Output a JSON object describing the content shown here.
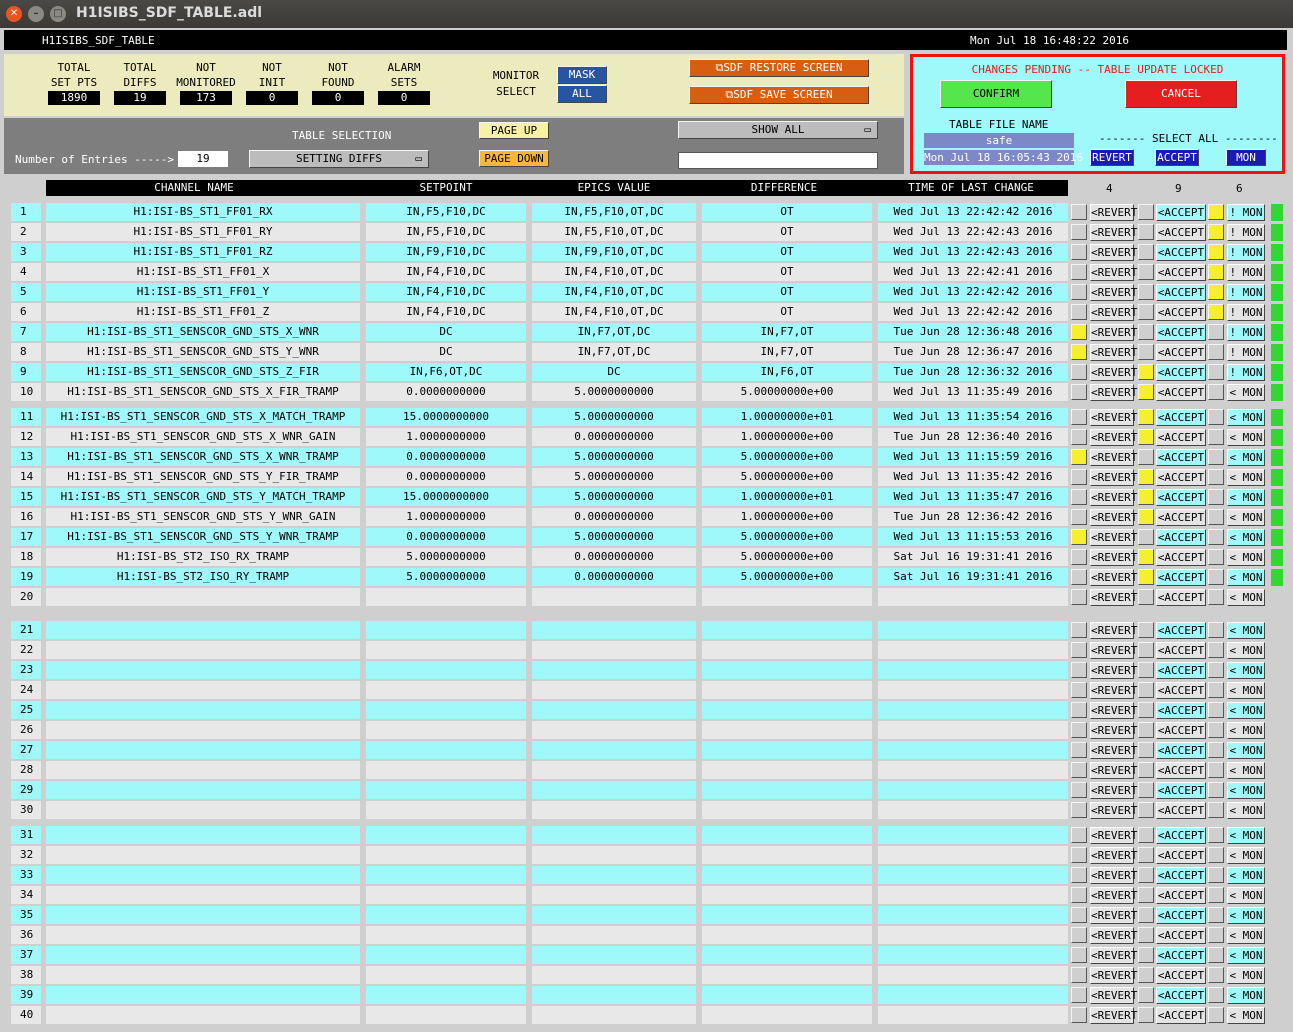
{
  "window": {
    "title": "H1ISIBS_SDF_TABLE.adl"
  },
  "header": {
    "left": "H1ISIBS_SDF_TABLE",
    "right": "Mon Jul 18 16:48:22 2016"
  },
  "stats": [
    {
      "l1": "TOTAL",
      "l2": "SET PTS",
      "value": "1890"
    },
    {
      "l1": "TOTAL",
      "l2": "DIFFS",
      "value": "19"
    },
    {
      "l1": "NOT",
      "l2": "MONITORED",
      "value": "173"
    },
    {
      "l1": "NOT",
      "l2": "INIT",
      "value": "0"
    },
    {
      "l1": "NOT",
      "l2": "FOUND",
      "value": "0"
    },
    {
      "l1": "ALARM",
      "l2": "SETS",
      "value": "0"
    }
  ],
  "monitor": {
    "l1": "MONITOR",
    "l2": "SELECT",
    "mask": "MASK",
    "all": "ALL"
  },
  "restore_label": "SDF RESTORE SCREEN",
  "save_label": "SDF SAVE SCREEN",
  "selection": {
    "entries_label": "Number of Entries ----->",
    "entries": "19",
    "table_selection": "TABLE SELECTION",
    "setting": "SETTING DIFFS",
    "page_up": "PAGE UP",
    "page_down": "PAGE DOWN",
    "show_all": "SHOW ALL",
    "filter": ""
  },
  "pending": {
    "status": "CHANGES PENDING -- TABLE UPDATE LOCKED",
    "confirm": "CONFIRM",
    "cancel": "CANCEL",
    "file_label": "TABLE FILE NAME",
    "file_name": "safe",
    "file_time": "Mon Jul 18 16:05:43 2016",
    "select_all": "------- SELECT ALL --------",
    "revert": "REVERT",
    "accept": "ACCEPT",
    "mon": "MON"
  },
  "columns": {
    "name": "CHANNEL NAME",
    "setpoint": "SETPOINT",
    "epics": "EPICS VALUE",
    "diff": "DIFFERENCE",
    "time": "TIME OF LAST CHANGE",
    "c4": "4",
    "c9": "9",
    "c6": "6"
  },
  "labels": {
    "revert": "<REVERT",
    "accept": "<ACCEPT",
    "notmon": "! MON",
    "mon": "< MON"
  },
  "rows": [
    {
      "name": "H1:ISI-BS_ST1_FF01_RX",
      "sp": "IN,F5,F10,DC",
      "ep": "IN,F5,F10,OT,DC",
      "df": "OT",
      "tm": "Wed Jul 13 22:42:42 2016",
      "r": 0,
      "a": 0,
      "m": 1,
      "nm": 1
    },
    {
      "name": "H1:ISI-BS_ST1_FF01_RY",
      "sp": "IN,F5,F10,DC",
      "ep": "IN,F5,F10,OT,DC",
      "df": "OT",
      "tm": "Wed Jul 13 22:42:43 2016",
      "r": 0,
      "a": 0,
      "m": 1,
      "nm": 1
    },
    {
      "name": "H1:ISI-BS_ST1_FF01_RZ",
      "sp": "IN,F9,F10,DC",
      "ep": "IN,F9,F10,OT,DC",
      "df": "OT",
      "tm": "Wed Jul 13 22:42:43 2016",
      "r": 0,
      "a": 0,
      "m": 1,
      "nm": 1
    },
    {
      "name": "H1:ISI-BS_ST1_FF01_X",
      "sp": "IN,F4,F10,DC",
      "ep": "IN,F4,F10,OT,DC",
      "df": "OT",
      "tm": "Wed Jul 13 22:42:41 2016",
      "r": 0,
      "a": 0,
      "m": 1,
      "nm": 1
    },
    {
      "name": "H1:ISI-BS_ST1_FF01_Y",
      "sp": "IN,F4,F10,DC",
      "ep": "IN,F4,F10,OT,DC",
      "df": "OT",
      "tm": "Wed Jul 13 22:42:42 2016",
      "r": 0,
      "a": 0,
      "m": 1,
      "nm": 1
    },
    {
      "name": "H1:ISI-BS_ST1_FF01_Z",
      "sp": "IN,F4,F10,DC",
      "ep": "IN,F4,F10,OT,DC",
      "df": "OT",
      "tm": "Wed Jul 13 22:42:42 2016",
      "r": 0,
      "a": 0,
      "m": 1,
      "nm": 1
    },
    {
      "name": "H1:ISI-BS_ST1_SENSCOR_GND_STS_X_WNR",
      "sp": "DC",
      "ep": "IN,F7,OT,DC",
      "df": "IN,F7,OT",
      "tm": "Tue Jun 28 12:36:48 2016",
      "r": 1,
      "a": 0,
      "m": 0,
      "nm": 1
    },
    {
      "name": "H1:ISI-BS_ST1_SENSCOR_GND_STS_Y_WNR",
      "sp": "DC",
      "ep": "IN,F7,OT,DC",
      "df": "IN,F7,OT",
      "tm": "Tue Jun 28 12:36:47 2016",
      "r": 1,
      "a": 0,
      "m": 0,
      "nm": 1
    },
    {
      "name": "H1:ISI-BS_ST1_SENSCOR_GND_STS_Z_FIR",
      "sp": "IN,F6,OT,DC",
      "ep": "DC",
      "df": "IN,F6,OT",
      "tm": "Tue Jun 28 12:36:32 2016",
      "r": 0,
      "a": 1,
      "m": 0,
      "nm": 1
    },
    {
      "name": "H1:ISI-BS_ST1_SENSCOR_GND_STS_X_FIR_TRAMP",
      "sp": "0.0000000000",
      "ep": "5.0000000000",
      "df": "5.00000000e+00",
      "tm": "Wed Jul 13 11:35:49 2016",
      "r": 0,
      "a": 1,
      "m": 0,
      "nm": 0
    },
    {
      "name": "H1:ISI-BS_ST1_SENSCOR_GND_STS_X_MATCH_TRAMP",
      "sp": "15.0000000000",
      "ep": "5.0000000000",
      "df": "1.00000000e+01",
      "tm": "Wed Jul 13 11:35:54 2016",
      "r": 0,
      "a": 1,
      "m": 0,
      "nm": 0
    },
    {
      "name": "H1:ISI-BS_ST1_SENSCOR_GND_STS_X_WNR_GAIN",
      "sp": "1.0000000000",
      "ep": "0.0000000000",
      "df": "1.00000000e+00",
      "tm": "Tue Jun 28 12:36:40 2016",
      "r": 0,
      "a": 1,
      "m": 0,
      "nm": 0
    },
    {
      "name": "H1:ISI-BS_ST1_SENSCOR_GND_STS_X_WNR_TRAMP",
      "sp": "0.0000000000",
      "ep": "5.0000000000",
      "df": "5.00000000e+00",
      "tm": "Wed Jul 13 11:15:59 2016",
      "r": 1,
      "a": 0,
      "m": 0,
      "nm": 0
    },
    {
      "name": "H1:ISI-BS_ST1_SENSCOR_GND_STS_Y_FIR_TRAMP",
      "sp": "0.0000000000",
      "ep": "5.0000000000",
      "df": "5.00000000e+00",
      "tm": "Wed Jul 13 11:35:42 2016",
      "r": 0,
      "a": 1,
      "m": 0,
      "nm": 0
    },
    {
      "name": "H1:ISI-BS_ST1_SENSCOR_GND_STS_Y_MATCH_TRAMP",
      "sp": "15.0000000000",
      "ep": "5.0000000000",
      "df": "1.00000000e+01",
      "tm": "Wed Jul 13 11:35:47 2016",
      "r": 0,
      "a": 1,
      "m": 0,
      "nm": 0
    },
    {
      "name": "H1:ISI-BS_ST1_SENSCOR_GND_STS_Y_WNR_GAIN",
      "sp": "1.0000000000",
      "ep": "0.0000000000",
      "df": "1.00000000e+00",
      "tm": "Tue Jun 28 12:36:42 2016",
      "r": 0,
      "a": 1,
      "m": 0,
      "nm": 0
    },
    {
      "name": "H1:ISI-BS_ST1_SENSCOR_GND_STS_Y_WNR_TRAMP",
      "sp": "0.0000000000",
      "ep": "5.0000000000",
      "df": "5.00000000e+00",
      "tm": "Wed Jul 13 11:15:53 2016",
      "r": 1,
      "a": 0,
      "m": 0,
      "nm": 0
    },
    {
      "name": "H1:ISI-BS_ST2_ISO_RX_TRAMP",
      "sp": "5.0000000000",
      "ep": "0.0000000000",
      "df": "5.00000000e+00",
      "tm": "Sat Jul 16 19:31:41 2016",
      "r": 0,
      "a": 1,
      "m": 0,
      "nm": 0
    },
    {
      "name": "H1:ISI-BS_ST2_ISO_RY_TRAMP",
      "sp": "5.0000000000",
      "ep": "0.0000000000",
      "df": "5.00000000e+00",
      "tm": "Sat Jul 16 19:31:41 2016",
      "r": 0,
      "a": 1,
      "m": 0,
      "nm": 0
    }
  ],
  "total_rows": 40
}
